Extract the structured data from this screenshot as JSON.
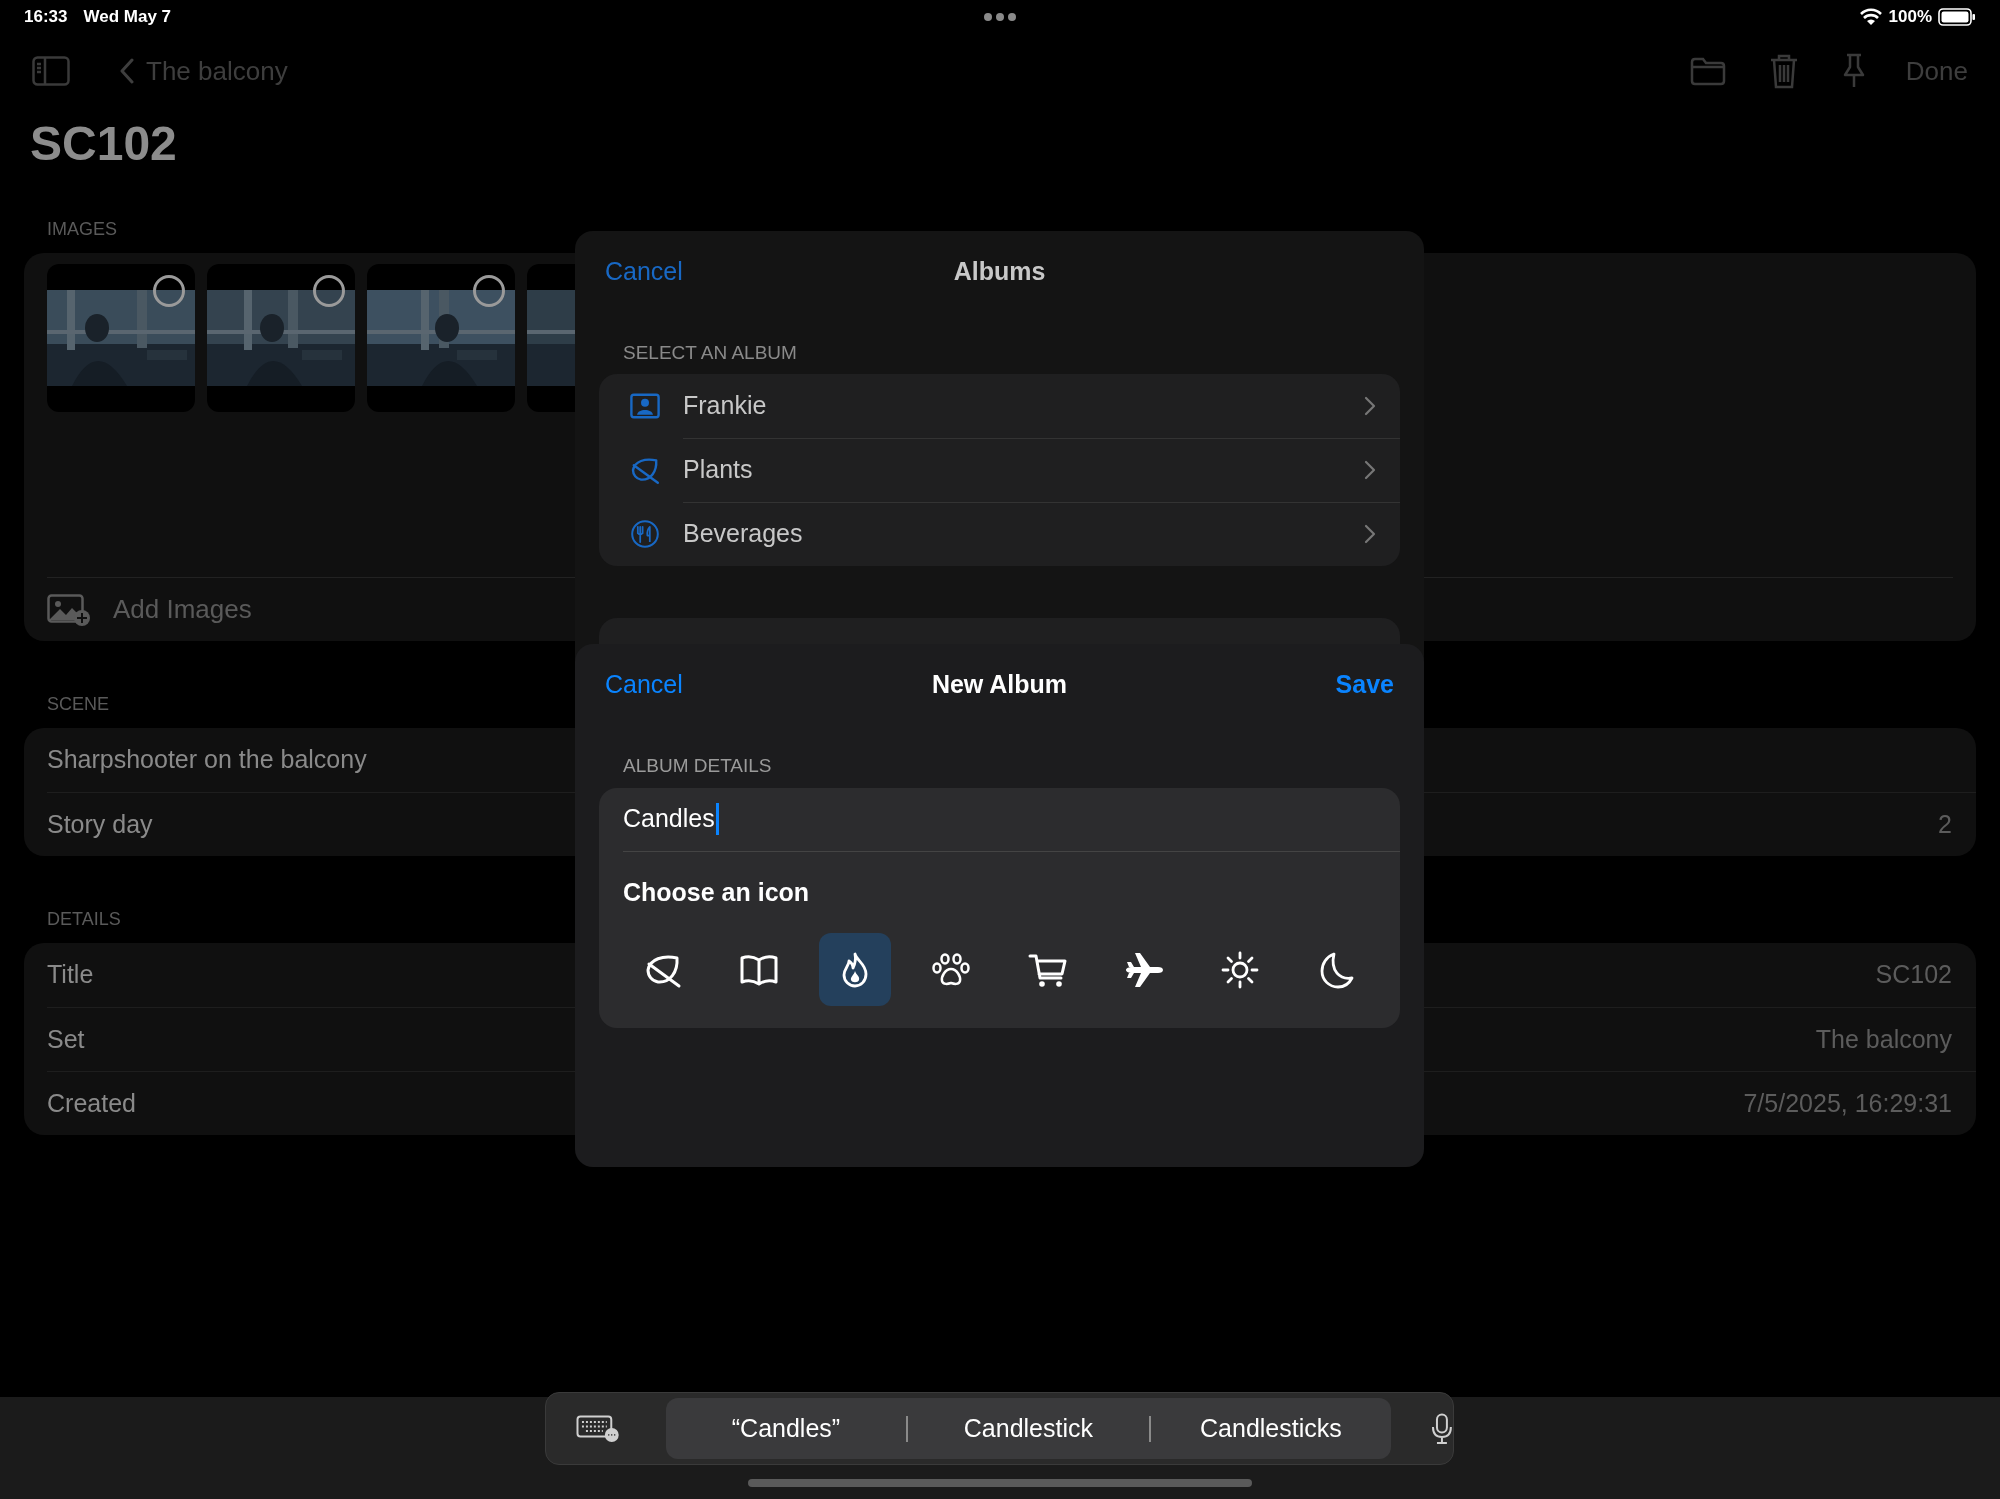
{
  "status_bar": {
    "time": "16:33",
    "date": "Wed May 7",
    "battery": "100%"
  },
  "nav": {
    "back_label": "The balcony",
    "done": "Done"
  },
  "title": "SC102",
  "images": {
    "header": "IMAGES",
    "add_label": "Add Images"
  },
  "scene": {
    "header": "SCENE",
    "rows": [
      {
        "label": "Sharpshooter on the balcony"
      },
      {
        "label": "Story day",
        "value": "2"
      }
    ]
  },
  "details": {
    "header": "DETAILS",
    "rows": [
      {
        "label": "Title",
        "value": "SC102"
      },
      {
        "label": "Set",
        "value": "The balcony"
      },
      {
        "label": "Created",
        "value": "7/5/2025, 16:29:31"
      }
    ]
  },
  "albums_sheet": {
    "cancel": "Cancel",
    "title": "Albums",
    "section": "SELECT AN ALBUM",
    "albums": [
      {
        "name": "Frankie",
        "kind": "person"
      },
      {
        "name": "Plants",
        "kind": "leaf"
      },
      {
        "name": "Beverages",
        "kind": "fork"
      }
    ]
  },
  "new_album_sheet": {
    "cancel": "Cancel",
    "title": "New Album",
    "save": "Save",
    "section": "ALBUM DETAILS",
    "name_value": "Candles",
    "icon_heading": "Choose an icon",
    "icons": [
      {
        "kind": "leaf",
        "selected": false
      },
      {
        "kind": "book",
        "selected": false
      },
      {
        "kind": "flame",
        "selected": true
      },
      {
        "kind": "paw",
        "selected": false
      },
      {
        "kind": "cart",
        "selected": false
      },
      {
        "kind": "airplane",
        "selected": false
      },
      {
        "kind": "sun",
        "selected": false
      },
      {
        "kind": "moon",
        "selected": false
      }
    ]
  },
  "keyboard_bar": {
    "suggestions": [
      "“Candles”",
      "Candlestick",
      "Candlesticks"
    ]
  }
}
